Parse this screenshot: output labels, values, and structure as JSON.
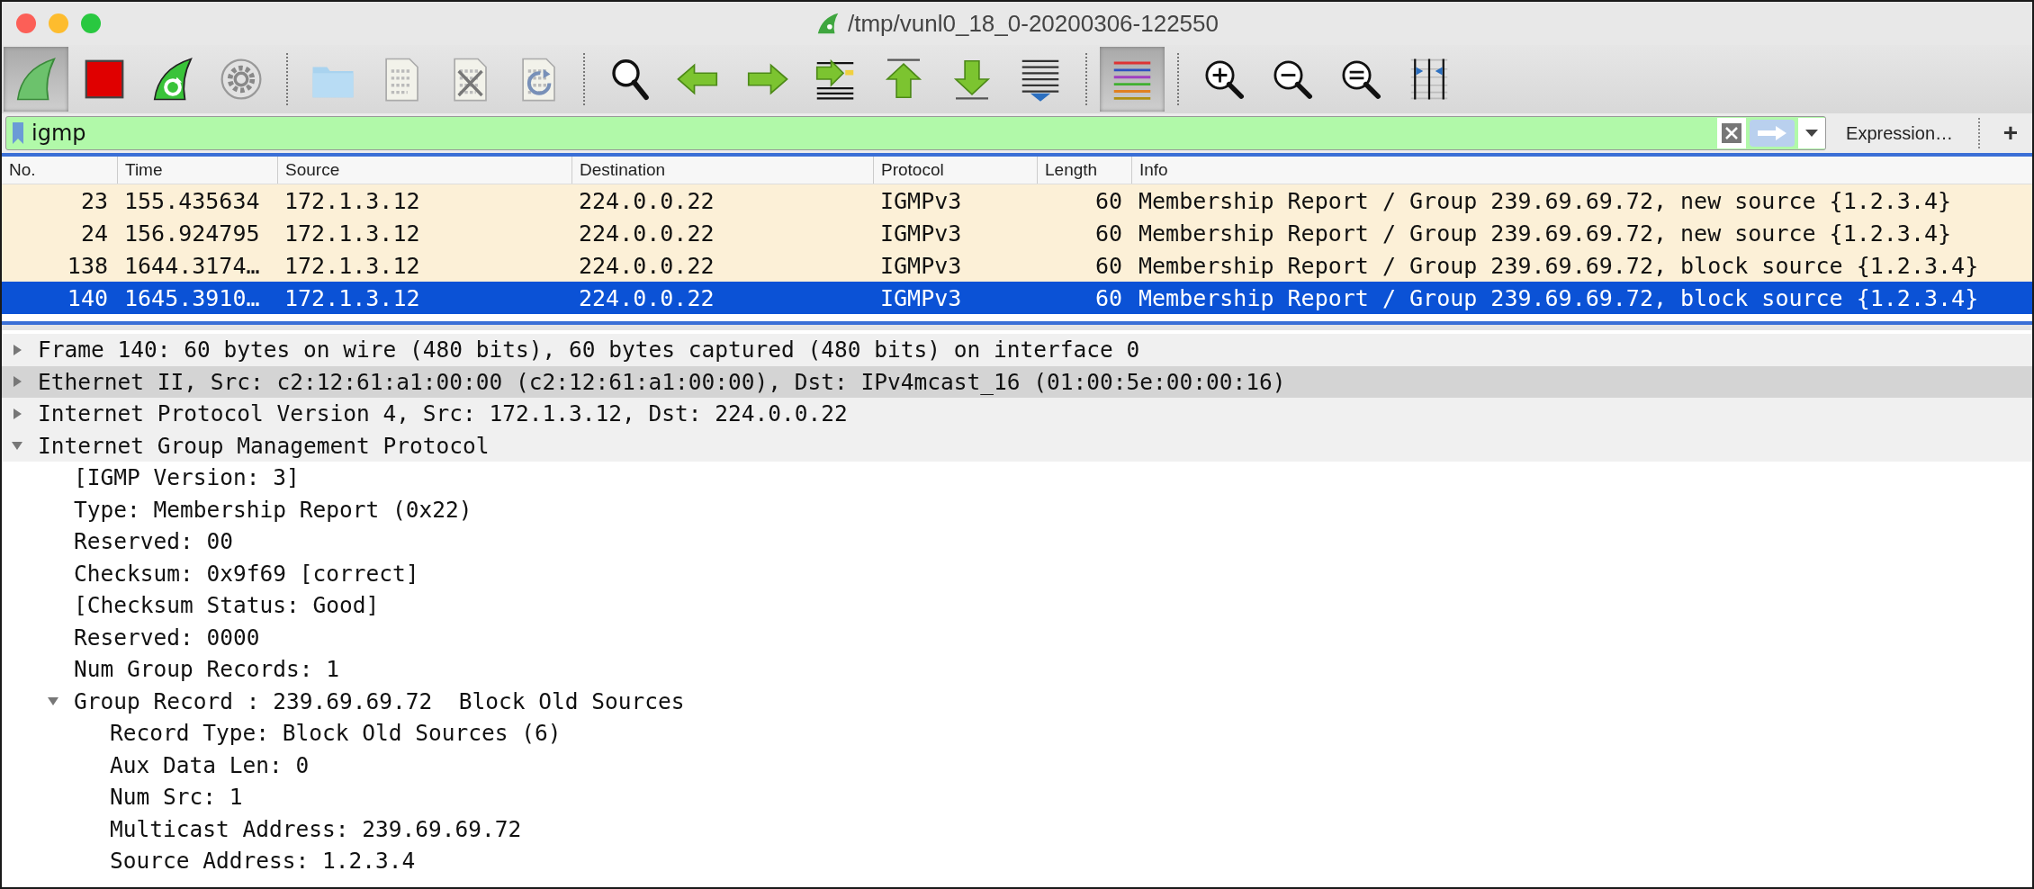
{
  "window": {
    "title": "/tmp/vunl0_18_0-20200306-122550"
  },
  "toolbar": {
    "groups": [
      [
        {
          "kind": "fin",
          "on": true
        },
        {
          "kind": "stop",
          "on": false
        },
        {
          "kind": "restart",
          "on": false
        },
        {
          "kind": "gear",
          "on": false
        }
      ],
      [
        {
          "kind": "folder",
          "on": false
        },
        {
          "kind": "file",
          "on": false
        },
        {
          "kind": "close-file",
          "on": false
        },
        {
          "kind": "reload-file",
          "on": false
        }
      ],
      [
        {
          "kind": "find",
          "on": false
        },
        {
          "kind": "back",
          "on": false
        },
        {
          "kind": "forward",
          "on": false
        },
        {
          "kind": "goto",
          "on": false
        },
        {
          "kind": "first",
          "on": false
        },
        {
          "kind": "last",
          "on": false
        },
        {
          "kind": "autoscroll",
          "on": false
        }
      ],
      [
        {
          "kind": "colorize",
          "on": true
        }
      ],
      [
        {
          "kind": "zoom-in",
          "on": false
        },
        {
          "kind": "zoom-out",
          "on": false
        },
        {
          "kind": "zoom-reset",
          "on": false
        },
        {
          "kind": "resize-columns",
          "on": false
        }
      ]
    ]
  },
  "filter": {
    "value": "igmp",
    "expression_button": "Expression…",
    "add_button": "+"
  },
  "packets": {
    "columns": [
      {
        "label": "No.",
        "kind": "number"
      },
      {
        "label": "Time",
        "kind": "text"
      },
      {
        "label": "Source",
        "kind": "text"
      },
      {
        "label": "Destination",
        "kind": "text"
      },
      {
        "label": "Protocol",
        "kind": "text"
      },
      {
        "label": "Length",
        "kind": "number"
      },
      {
        "label": "Info",
        "kind": "text"
      }
    ],
    "rows": [
      {
        "selected": false,
        "cells": [
          "23",
          "155.435634",
          "172.1.3.12",
          "224.0.0.22",
          "IGMPv3",
          "60",
          "Membership Report / Group 239.69.69.72, new source {1.2.3.4}"
        ]
      },
      {
        "selected": false,
        "cells": [
          "24",
          "156.924795",
          "172.1.3.12",
          "224.0.0.22",
          "IGMPv3",
          "60",
          "Membership Report / Group 239.69.69.72, new source {1.2.3.4}"
        ]
      },
      {
        "selected": false,
        "cells": [
          "138",
          "1644.3174…",
          "172.1.3.12",
          "224.0.0.22",
          "IGMPv3",
          "60",
          "Membership Report / Group 239.69.69.72, block source {1.2.3.4}"
        ]
      },
      {
        "selected": true,
        "cells": [
          "140",
          "1645.3910…",
          "172.1.3.12",
          "224.0.0.22",
          "IGMPv3",
          "60",
          "Membership Report / Group 239.69.69.72, block source {1.2.3.4}"
        ]
      }
    ]
  },
  "details": {
    "items": [
      {
        "text": "Frame 140: 60 bytes on wire (480 bits), 60 bytes captured (480 bits) on interface 0",
        "expanded": false,
        "selected": false
      },
      {
        "text": "Ethernet II, Src: c2:12:61:a1:00:00 (c2:12:61:a1:00:00), Dst: IPv4mcast_16 (01:00:5e:00:00:16)",
        "expanded": false,
        "selected": true
      },
      {
        "text": "Internet Protocol Version 4, Src: 172.1.3.12, Dst: 224.0.0.22",
        "expanded": false,
        "selected": false
      },
      {
        "text": "Internet Group Management Protocol",
        "expanded": true,
        "selected": false,
        "children": [
          {
            "text": "[IGMP Version: 3]",
            "selected": false
          },
          {
            "text": "Type: Membership Report (0x22)",
            "selected": false
          },
          {
            "text": "Reserved: 00",
            "selected": false
          },
          {
            "text": "Checksum: 0x9f69 [correct]",
            "selected": false
          },
          {
            "text": "[Checksum Status: Good]",
            "selected": false
          },
          {
            "text": "Reserved: 0000",
            "selected": false
          },
          {
            "text": "Num Group Records: 1",
            "selected": false
          },
          {
            "text": "Group Record : 239.69.69.72  Block Old Sources",
            "expanded": true,
            "selected": false,
            "children": [
              {
                "text": "Record Type: Block Old Sources (6)",
                "selected": false
              },
              {
                "text": "Aux Data Len: 0",
                "selected": false
              },
              {
                "text": "Num Src: 1",
                "selected": false
              },
              {
                "text": "Multicast Address: 239.69.69.72",
                "selected": false
              },
              {
                "text": "Source Address: 1.2.3.4",
                "selected": false
              }
            ]
          }
        ]
      }
    ]
  }
}
